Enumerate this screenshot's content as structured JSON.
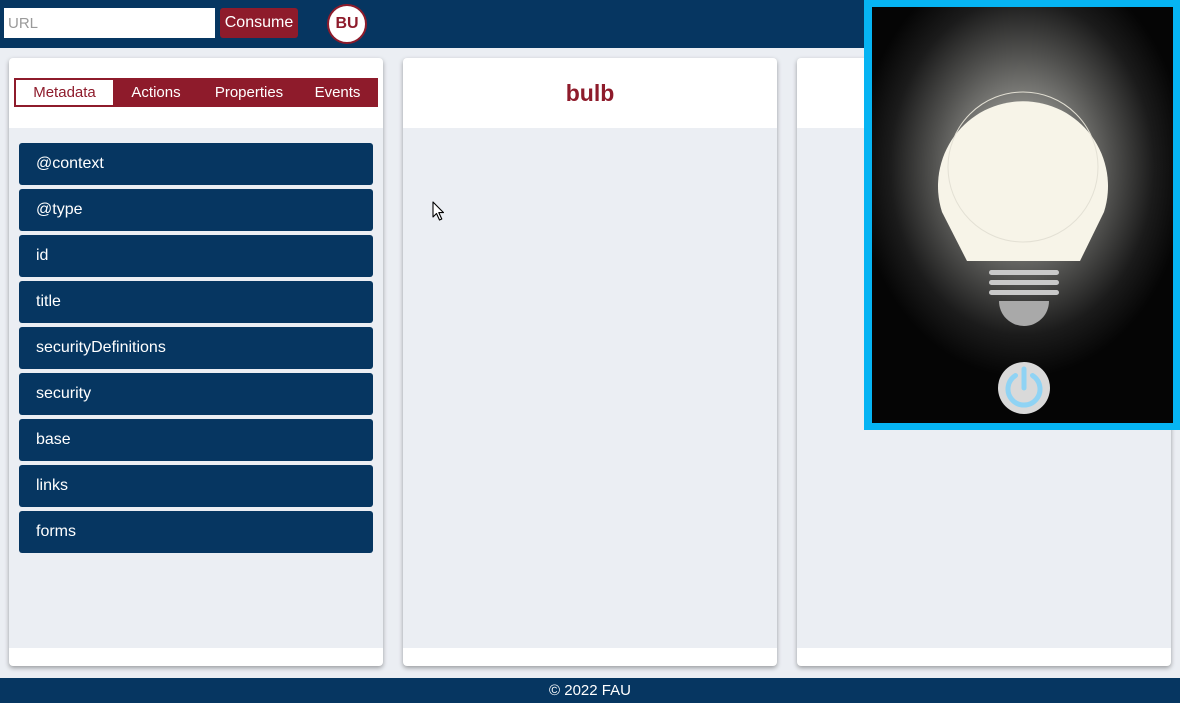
{
  "header": {
    "url_placeholder": "URL",
    "url_value": "",
    "consume_label": "Consume",
    "avatar_initials": "BU"
  },
  "left_panel": {
    "tabs": [
      {
        "label": "Metadata",
        "active": true
      },
      {
        "label": "Actions",
        "active": false
      },
      {
        "label": "Properties",
        "active": false
      },
      {
        "label": "Events",
        "active": false
      }
    ],
    "metadata_items": [
      "@context",
      "@type",
      "id",
      "title",
      "securityDefinitions",
      "security",
      "base",
      "links",
      "forms"
    ]
  },
  "middle_panel": {
    "title": "bulb"
  },
  "bulb_popup": {
    "state": "on",
    "icons": [
      "light-bulb-icon",
      "power-icon"
    ]
  },
  "footer": {
    "text": "© 2022 FAU"
  },
  "colors": {
    "navy": "#063661",
    "maroon": "#8e1b2b",
    "panel_bg": "#ebeef3",
    "popup_border": "#06b4f3",
    "bulb_glass": "#f7f4e8",
    "power_accent": "#8fd3f4"
  }
}
